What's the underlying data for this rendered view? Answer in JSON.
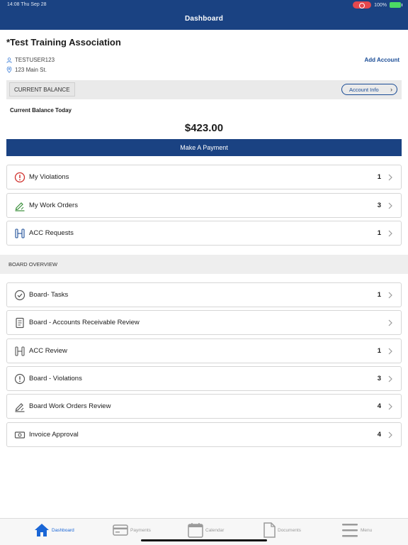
{
  "status_bar": {
    "time": "14:08  Thu Sep 28",
    "battery": "100%"
  },
  "header": {
    "title": "Dashboard"
  },
  "account": {
    "association_name": "*Test Training Association",
    "username": "TESTUSER123",
    "address": "123 Main St.",
    "add_account_label": "Add Account"
  },
  "balance": {
    "tab_label": "CURRENT BALANCE",
    "account_info_label": "Account Info",
    "today_label": "Current Balance Today",
    "amount": "$423.00",
    "pay_button_label": "Make A Payment"
  },
  "my_items": [
    {
      "label": "My Violations",
      "count": "1",
      "icon": "alert-circle-icon"
    },
    {
      "label": "My Work Orders",
      "count": "3",
      "icon": "work-order-icon"
    },
    {
      "label": "ACC Requests",
      "count": "1",
      "icon": "acc-request-icon"
    }
  ],
  "board_section_label": "BOARD OVERVIEW",
  "board_items": [
    {
      "label": "Board- Tasks",
      "count": "1",
      "icon": "check-circle-icon"
    },
    {
      "label": "Board - Accounts Receivable Review",
      "count": "",
      "icon": "ledger-icon"
    },
    {
      "label": "ACC Review",
      "count": "1",
      "icon": "acc-review-icon"
    },
    {
      "label": "Board - Violations",
      "count": "3",
      "icon": "alert-circle-icon"
    },
    {
      "label": "Board Work Orders Review",
      "count": "4",
      "icon": "work-order-icon"
    },
    {
      "label": "Invoice Approval",
      "count": "4",
      "icon": "money-icon"
    }
  ],
  "tabs": [
    {
      "label": "Dashboard",
      "icon": "home-icon",
      "active": true
    },
    {
      "label": "Payments",
      "icon": "credit-card-icon",
      "active": false
    },
    {
      "label": "Calendar",
      "icon": "calendar-icon",
      "active": false
    },
    {
      "label": "Documents",
      "icon": "document-icon",
      "active": false
    },
    {
      "label": "Menu",
      "icon": "menu-icon",
      "active": false
    }
  ],
  "colors": {
    "brand": "#1a4282",
    "link": "#1a4c96",
    "violation_red": "#d0312d",
    "work_green": "#3a8f3a",
    "tab_active": "#1a66d6"
  }
}
